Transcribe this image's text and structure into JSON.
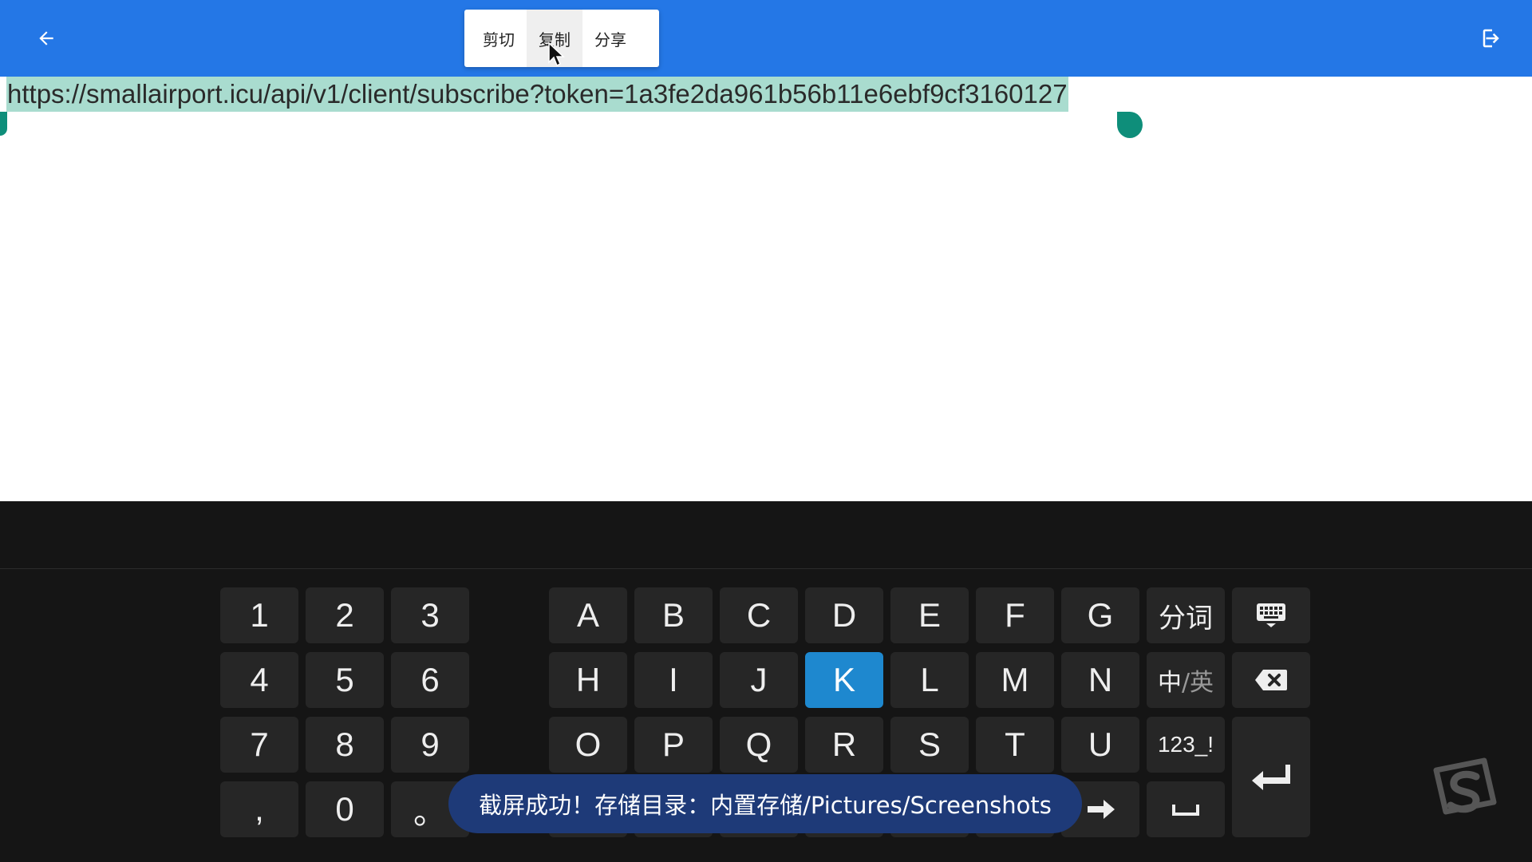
{
  "appbar": {
    "back_icon": "arrow-left-icon",
    "exit_icon": "login-enter-icon"
  },
  "context_menu": {
    "items": [
      {
        "label": "剪切"
      },
      {
        "label": "复制"
      },
      {
        "label": "分享"
      }
    ]
  },
  "editor": {
    "selected_text": "https://smallairport.icu/api/v1/client/subscribe?token=1a3fe2da961b56b11e6ebf9cf3160127"
  },
  "keyboard": {
    "numpad": [
      "1",
      "2",
      "3",
      "4",
      "5",
      "6",
      "7",
      "8",
      "9",
      ",",
      "0",
      "。"
    ],
    "letters_row1": [
      "A",
      "B",
      "C",
      "D",
      "E",
      "F",
      "G"
    ],
    "letters_row2": [
      "H",
      "I",
      "J",
      "K",
      "L",
      "M",
      "N"
    ],
    "letters_row3": [
      "O",
      "P",
      "Q",
      "R",
      "S",
      "T",
      "U"
    ],
    "selected_key": "K",
    "segment_label": "分词",
    "lang_label_zh": "中",
    "lang_label_en": "/英",
    "symbols_label": "123_!"
  },
  "toast": {
    "message": "截屏成功！存储目录：内置存储/Pictures/Screenshots"
  },
  "colors": {
    "appbar": "#2477E6",
    "selection": "#A9DCCF",
    "handle": "#0E8E7A",
    "keyboard_bg": "#151515",
    "key_bg": "#262626",
    "key_selected": "#1E88CF",
    "toast_bg": "#1E3A78"
  }
}
